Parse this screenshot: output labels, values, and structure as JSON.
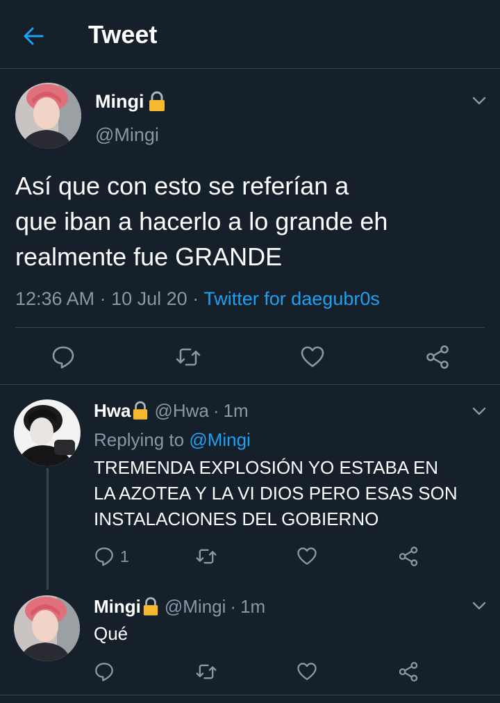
{
  "header": {
    "title": "Tweet",
    "back_icon": "arrow-left-icon"
  },
  "colors": {
    "background": "#15202b",
    "accent": "#1da1f2",
    "muted": "#8899a6",
    "divider": "#38444d",
    "lock": "#f5b82e"
  },
  "main_tweet": {
    "name": "Mingi",
    "handle": "@Mingi",
    "text_lines": [
      "Así que con esto se referían a",
      "que iban a hacerlo a lo grande eh",
      "realmente fue GRANDE"
    ],
    "time": "12:36 AM",
    "date": "10 Jul 20",
    "separator": "·",
    "source": "Twitter for daegubr0s"
  },
  "replies": [
    {
      "name": "Hwa",
      "handle": "@Hwa",
      "age": "1m",
      "replying_label": "Replying to",
      "replying_to": "@Mingi",
      "text_lines": [
        "TREMENDA EXPLOSIÓN YO ESTABA EN",
        "LA AZOTEA Y LA VI DIOS PERO ESAS SON",
        "INSTALACIONES DEL GOBIERNO"
      ],
      "reply_count": "1"
    },
    {
      "name": "Mingi",
      "handle": "@Mingi",
      "age": "1m",
      "text_lines": [
        "Qué"
      ]
    }
  ]
}
